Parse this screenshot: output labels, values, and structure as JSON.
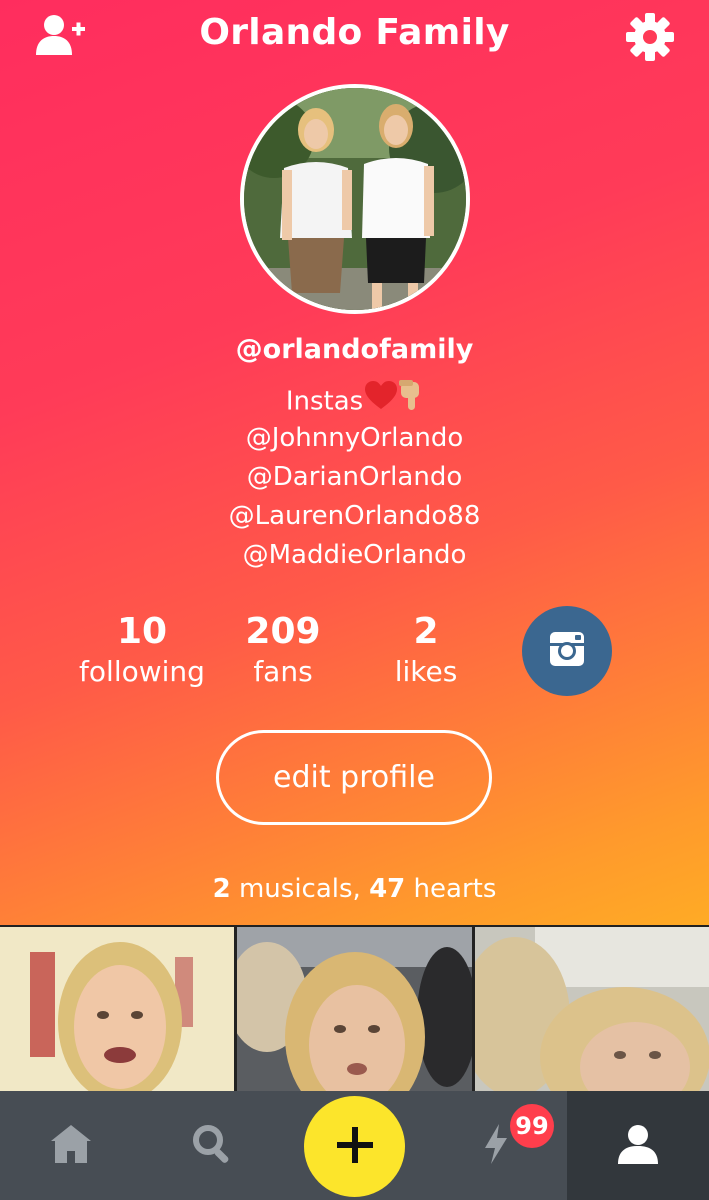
{
  "header": {
    "title": "Orlando Family",
    "add_friend_icon": "add-friend-icon",
    "settings_icon": "gear-icon"
  },
  "profile": {
    "handle": "@orlandofamily",
    "bio": {
      "first_line": "Instas",
      "first_line_emoji": [
        "heart-emoji",
        "point-down-emoji"
      ],
      "lines": [
        "@JohnnyOrlando",
        "@DarianOrlando",
        "@LaurenOrlando88",
        "@MaddieOrlando"
      ]
    }
  },
  "stats": [
    {
      "value": "10",
      "label": "following"
    },
    {
      "value": "209",
      "label": "fans"
    },
    {
      "value": "2",
      "label": "likes"
    }
  ],
  "instagram_button_icon": "instagram-icon",
  "edit_profile_label": "edit profile",
  "summary": {
    "musicals_count": "2",
    "musicals_label": "musicals,",
    "hearts_count": "47",
    "hearts_label": "hearts"
  },
  "tabbar": {
    "items": [
      {
        "name": "home",
        "icon": "home-icon"
      },
      {
        "name": "search",
        "icon": "search-icon"
      },
      {
        "name": "create",
        "icon": "plus-icon"
      },
      {
        "name": "notifications",
        "icon": "lightning-icon"
      },
      {
        "name": "profile",
        "icon": "person-icon"
      }
    ],
    "notification_badge": "99"
  },
  "colors": {
    "gradient_top": "#ff2d5e",
    "gradient_bottom": "#ffab25",
    "instagram_button": "#3b6790",
    "create_button": "#fce52b",
    "badge": "#ff3e4c",
    "tabbar": "#474d54"
  }
}
